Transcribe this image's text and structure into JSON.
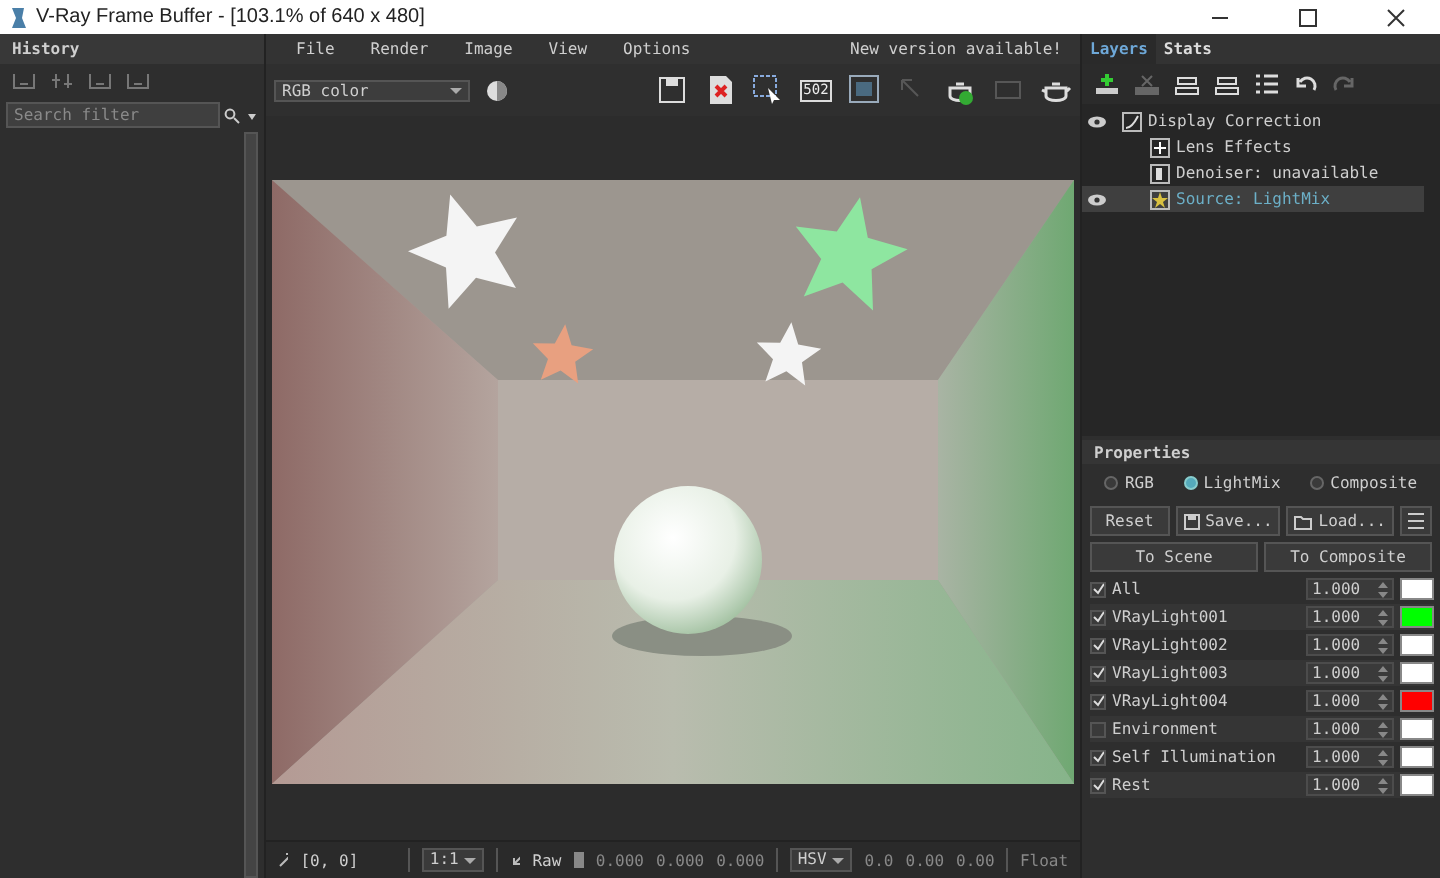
{
  "window": {
    "title": "V-Ray Frame Buffer - [103.1% of 640 x 480]"
  },
  "history": {
    "title": "History",
    "search": {
      "placeholder": "Search filter"
    }
  },
  "menu": [
    "File",
    "Render",
    "Image",
    "View",
    "Options"
  ],
  "notice": "New version available!",
  "channel_select": {
    "value": "RGB color"
  },
  "toolbar": [
    {
      "kind": "save",
      "disabled": false
    },
    {
      "kind": "clear",
      "disabled": false
    },
    {
      "kind": "region",
      "disabled": false
    },
    {
      "kind": "compare",
      "label": "502",
      "disabled": false
    },
    {
      "kind": "frame",
      "disabled": false
    },
    {
      "kind": "cursor",
      "disabled": true
    },
    {
      "kind": "teapot-render",
      "disabled": false
    },
    {
      "kind": "stop",
      "disabled": true
    },
    {
      "kind": "teapot",
      "disabled": false
    }
  ],
  "layer_tabs": [
    {
      "label": "Layers",
      "selected": true
    },
    {
      "label": "Stats",
      "selected": false
    }
  ],
  "layers": [
    {
      "label": "Display Correction",
      "kind": "curve",
      "visible": true,
      "selected": false,
      "children": [
        {
          "label": "Lens Effects",
          "kind": "lens",
          "visible": false,
          "selected": false
        },
        {
          "label": "Denoiser: unavailable",
          "kind": "denoiser",
          "visible": false,
          "selected": false
        },
        {
          "label": "Source: LightMix",
          "kind": "source",
          "visible": true,
          "selected": true
        }
      ]
    }
  ],
  "properties": {
    "title": "Properties",
    "modes": [
      {
        "label": "RGB",
        "selected": false
      },
      {
        "label": "LightMix",
        "selected": true
      },
      {
        "label": "Composite",
        "selected": false
      }
    ],
    "buttons": [
      {
        "label": "Reset",
        "kind": "plain"
      },
      {
        "label": "Save...",
        "kind": "save"
      },
      {
        "label": "Load...",
        "kind": "load"
      }
    ],
    "actions": [
      "To Scene",
      "To Composite"
    ],
    "lights": [
      {
        "name": "All",
        "checked": true,
        "value": "1.000",
        "color": "#ffffff"
      },
      {
        "name": "VRayLight001",
        "checked": true,
        "value": "1.000",
        "color": "#00ff00"
      },
      {
        "name": "VRayLight002",
        "checked": true,
        "value": "1.000",
        "color": "#ffffff"
      },
      {
        "name": "VRayLight003",
        "checked": true,
        "value": "1.000",
        "color": "#ffffff"
      },
      {
        "name": "VRayLight004",
        "checked": true,
        "value": "1.000",
        "color": "#ff0000"
      },
      {
        "name": "Environment",
        "checked": false,
        "value": "1.000",
        "color": "#ffffff"
      },
      {
        "name": "Self Illumination",
        "checked": true,
        "value": "1.000",
        "color": "#ffffff"
      },
      {
        "name": "Rest",
        "checked": true,
        "value": "1.000",
        "color": "#ffffff"
      }
    ]
  },
  "status": {
    "coords": "[0, 0]",
    "zoom": "1:1",
    "mode": "Raw",
    "rgb": [
      "0.000",
      "0.000",
      "0.000"
    ],
    "space": "HSV",
    "hsv": [
      "0.0",
      "0.00",
      "0.00"
    ],
    "format": "Float"
  }
}
